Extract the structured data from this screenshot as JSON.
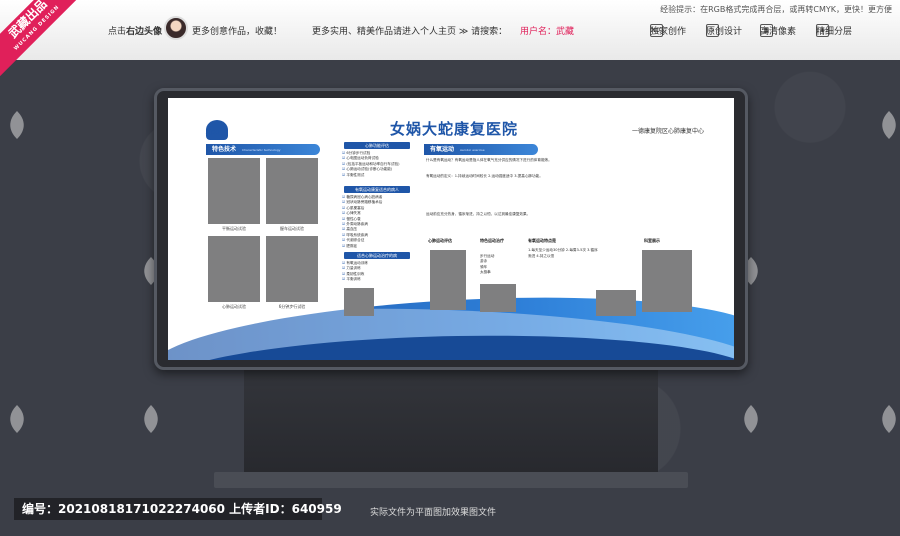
{
  "topbar": {
    "corner_brand": "武藏出品",
    "corner_sub": "WUCANG DESIGN",
    "tip": "经验提示：在RGB格式完成再合层，或再转CMYK，更快！更方便",
    "click_avatar": "点击",
    "click_avatar_hl": "右边头像",
    "more_works": "更多创意作品，收藏！",
    "main_link": "更多实用、精美作品请进入个人主页 ≫ 请搜索：",
    "user_label": "用户名：武藏",
    "badges": [
      {
        "icon": "NO.",
        "label": "独家创作"
      },
      {
        "icon": "✎",
        "label": "原创设计"
      },
      {
        "icon": "▦",
        "label": "高清像素"
      },
      {
        "icon": "◈",
        "label": "精细分层"
      }
    ]
  },
  "board": {
    "title": "女娲大蛇康复医院",
    "subtitle": "一德康复院区心肺康复中心",
    "logo_text": "Xpo",
    "left_head": "特色技术",
    "left_head_sub": "Characteristic technology",
    "captions": [
      "平衡运动试验",
      "握车运动试验",
      "心肺运动试验",
      "6分钟步行试验"
    ],
    "mid_heads": [
      "心肺功能评估",
      "有氧运动康复适合的病人",
      "适合心肺运动治疗的病"
    ],
    "mid_list1": [
      "6分钟步行试验",
      "心电图运动负荷试验",
      "(包括平板运动和功率自行车试验)",
      "心肺运动试验(诊断心功能能)",
      "平衡性测试"
    ],
    "mid_list2": [
      "糖尿病冠心病心脏病者",
      "冠状动脉旁路移植术后",
      "心肌梗塞后",
      "心律失常",
      "慢性心衰",
      "外周动脉疾病",
      "高血压",
      "呼吸系统疾病",
      "代谢综合征",
      "肥胖症"
    ],
    "mid_list3": [
      "有氧运动训练",
      "力量训练",
      "柔韧性训练",
      "平衡训练"
    ],
    "right_head": "有氧运动",
    "right_head_sub": "Aerobic exercise",
    "right_para1": "什么是有氧运动？有氧运动是指人体在氧气充分供应的情况下进行的体育锻炼。",
    "right_para2": "有氧运动的定义：1.持续运动时间较长 2.运动强度适中 3.提高心肺功能。",
    "right_para3": "运动前应充分热身，循序渐进，持之以恒，以达到最佳康复效果。",
    "col_titles": [
      "心肺运动评估",
      "特色运动治疗",
      "有氧运动特点是",
      "科室展示"
    ],
    "col_items": [
      "步行运动",
      "游泳",
      "骑车",
      "太极拳"
    ],
    "col3_para": "1.每天至少运动30分钟 2.每周3-5次 3.循序渐进 4.持之以恒"
  },
  "footer": {
    "id_text": "编号：20210818171022274060 上传者ID：640959",
    "note": "实际文件为平面图加效果图文件"
  }
}
